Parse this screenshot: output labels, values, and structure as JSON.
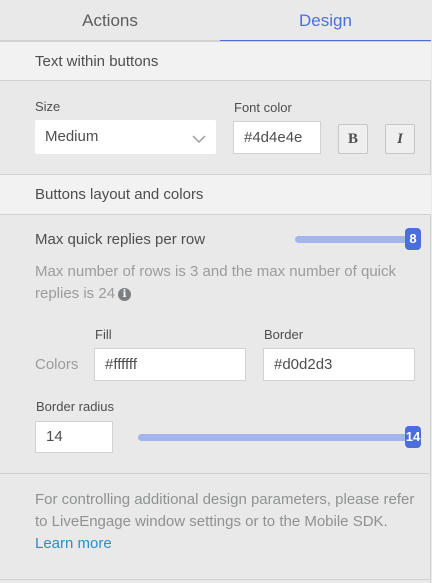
{
  "tabs": [
    {
      "label": "Actions",
      "active": false
    },
    {
      "label": "Design",
      "active": true
    }
  ],
  "text_section": {
    "header": "Text within buttons",
    "size_label": "Size",
    "size_value": "Medium",
    "font_color_label": "Font color",
    "font_color_value": "#4d4e4e",
    "bold_label": "B",
    "italic_label": "I"
  },
  "layout_section": {
    "header": "Buttons layout and colors",
    "max_replies_label": "Max quick replies per row",
    "max_replies_value": "8",
    "max_replies_fraction": 1.0,
    "info_text": "Max number of rows is 3 and the max number of quick replies is 24",
    "colors_label": "Colors",
    "fill_label": "Fill",
    "fill_value": "#ffffff",
    "border_label": "Border",
    "border_value": "#d0d2d3",
    "radius_label": "Border radius",
    "radius_value": "14",
    "radius_slider_value": "14",
    "radius_fraction": 1.0
  },
  "footer": {
    "text": "For controlling additional design parameters, please refer to LiveEngage window settings or to the Mobile SDK.",
    "link": "Learn more"
  },
  "colors": {
    "accent": "#4a6fdc",
    "track": "#a4b5ee",
    "link": "#2e8dc4"
  }
}
